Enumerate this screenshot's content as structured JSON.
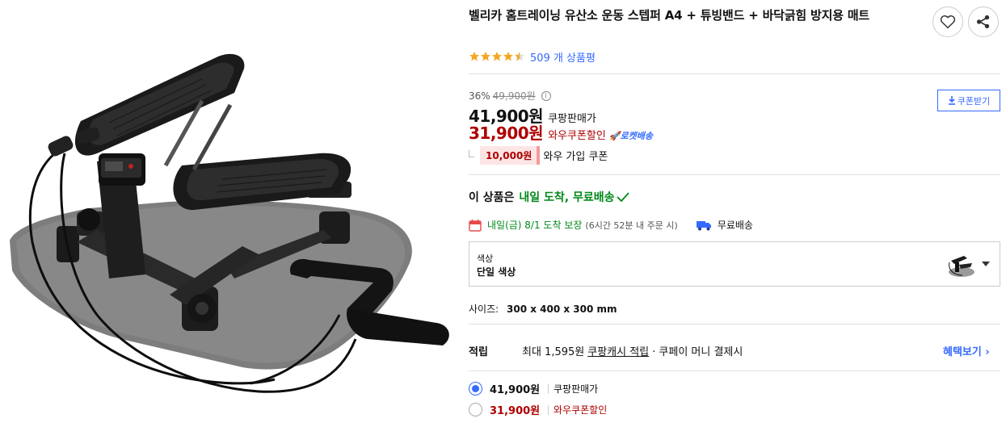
{
  "product": {
    "title": "벨리카 홈트레이닝 유산소 운동 스텝퍼 A4 + 튜빙밴드 + 바닥긁힘 방지용 매트",
    "rating": 4.5,
    "review_count_text": "509 개 상품평",
    "image_alt": "stepper-with-resistance-bands"
  },
  "actions": {
    "like_icon": "heart-icon",
    "share_icon": "share-icon"
  },
  "price": {
    "discount_rate": "36%",
    "original_price": "49,900원",
    "sale_price": "41,900원",
    "sale_label": "쿠팡판매가",
    "wow_price": "31,900원",
    "wow_label": "와우쿠폰할인",
    "rocket_label": "로켓배송",
    "coupon_button": "쿠폰받기",
    "wow_coupon_amount": "10,000원",
    "wow_coupon_text": "와우 가입 쿠폰"
  },
  "arrival": {
    "prefix": "이 상품은",
    "highlight": "내일 도착, 무료배송"
  },
  "delivery": {
    "date_text": "내일(금) 8/1 도착 보장",
    "note": "(6시간 52분 내 주문 시)",
    "free_shipping": "무료배송"
  },
  "option": {
    "name": "색상",
    "value": "단일 색상"
  },
  "size": {
    "label": "사이즈:",
    "value": "300 x 400 x 300 mm"
  },
  "points": {
    "label": "적립",
    "text1": "최대 1,595원",
    "link": "쿠팡캐시 적립",
    "text2": "· 쿠페이 머니 결제시",
    "benefit_link": "혜택보기 ›"
  },
  "radio_options": [
    {
      "price": "41,900원",
      "label": "쿠팡판매가",
      "selected": true
    },
    {
      "price": "31,900원",
      "label": "와우쿠폰할인",
      "selected": false
    }
  ],
  "colors": {
    "accent_blue": "#346aff",
    "wow_red": "#ae0000",
    "green": "#00891a",
    "star": "#f5a623"
  }
}
